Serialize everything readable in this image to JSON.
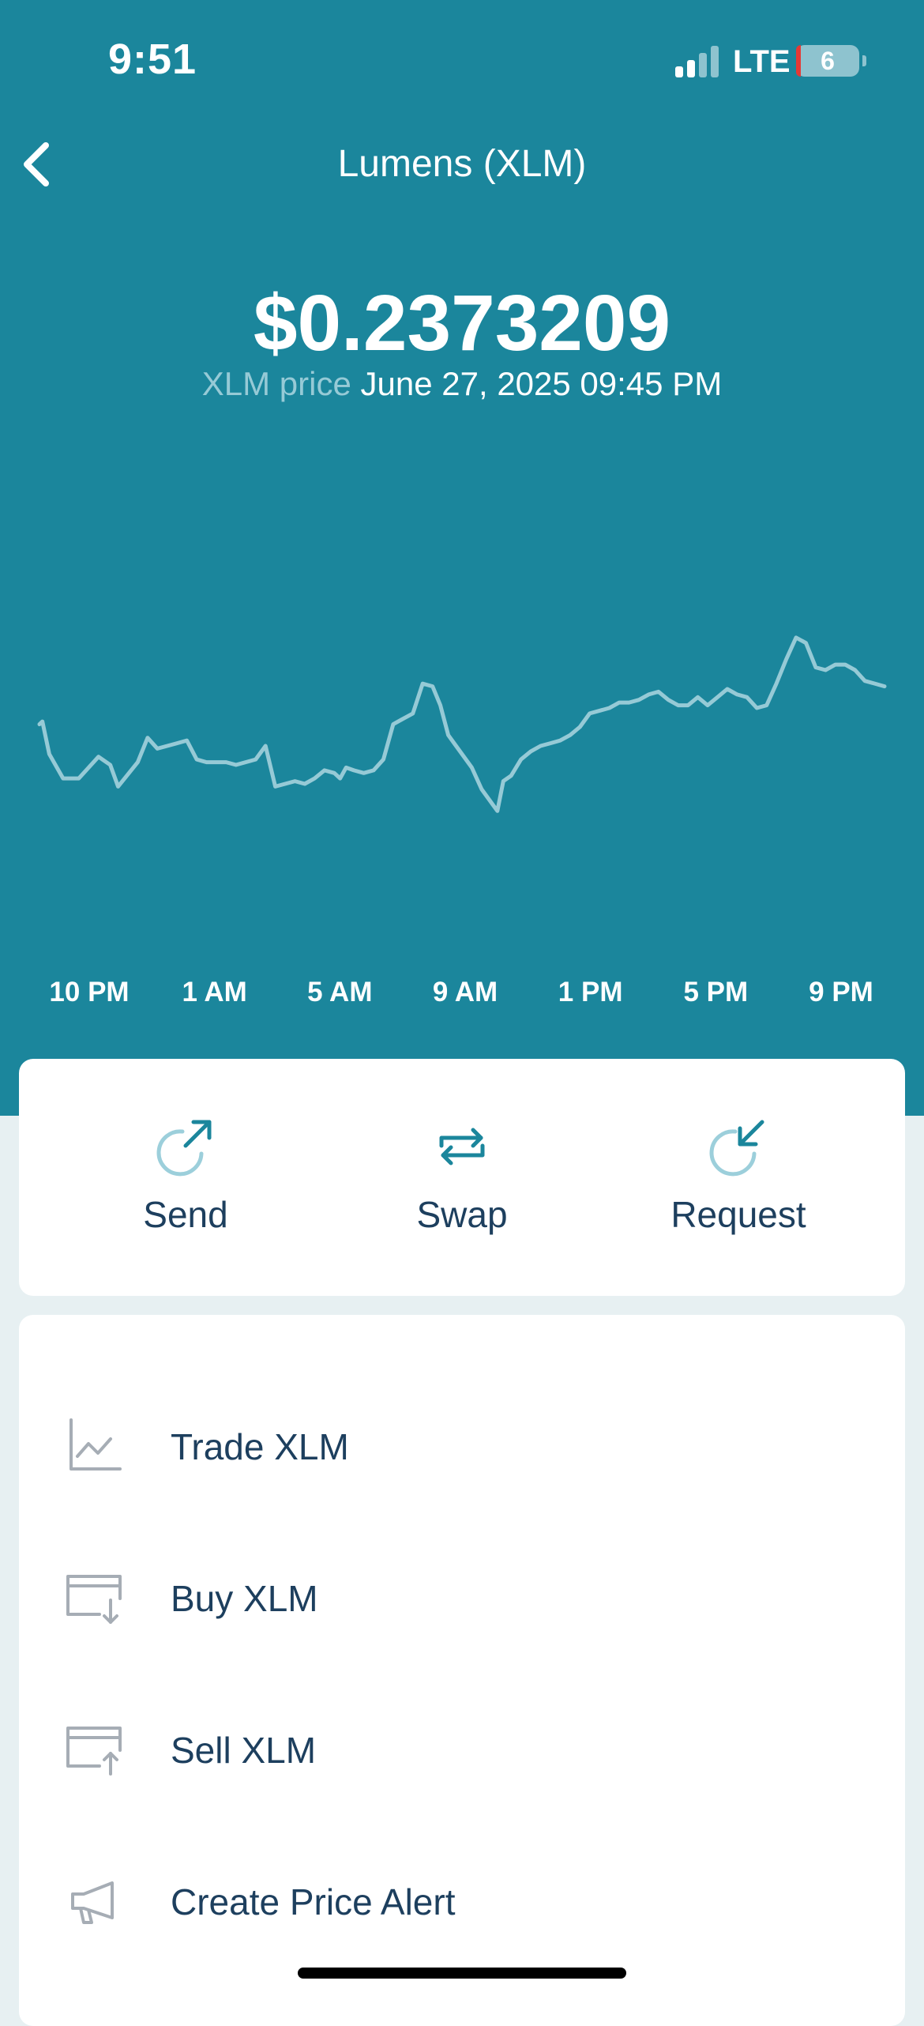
{
  "status_bar": {
    "time": "9:51",
    "network": "LTE",
    "battery": "6"
  },
  "header": {
    "title": "Lumens (XLM)"
  },
  "price": {
    "value": "$0.2373209",
    "label": "XLM price",
    "datetime": "June 27, 2025 09:45 PM"
  },
  "chart_data": {
    "type": "line",
    "x_ticks": [
      "10 PM",
      "1 AM",
      "5 AM",
      "9 AM",
      "1 PM",
      "5 PM",
      "9 PM"
    ],
    "ylim": [
      0.2255,
      0.2395
    ],
    "line_color": "#96cad6",
    "series": [
      {
        "points": [
          [
            0,
            0.2326
          ],
          [
            0.15,
            0.2327
          ],
          [
            0.5,
            0.2315
          ],
          [
            1.2,
            0.2306
          ],
          [
            2,
            0.2306
          ],
          [
            3,
            0.2314
          ],
          [
            3.6,
            0.2311
          ],
          [
            4,
            0.2303
          ],
          [
            5,
            0.2312
          ],
          [
            5.5,
            0.2321
          ],
          [
            6,
            0.2317
          ],
          [
            7,
            0.2319
          ],
          [
            7.5,
            0.232
          ],
          [
            8,
            0.2313
          ],
          [
            8.5,
            0.2312
          ],
          [
            9.5,
            0.2312
          ],
          [
            10,
            0.2311
          ],
          [
            11,
            0.2313
          ],
          [
            11.5,
            0.2318
          ],
          [
            12,
            0.2303
          ],
          [
            13,
            0.2305
          ],
          [
            13.5,
            0.2304
          ],
          [
            14,
            0.2306
          ],
          [
            14.5,
            0.2309
          ],
          [
            15,
            0.2308
          ],
          [
            15.3,
            0.2306
          ],
          [
            15.6,
            0.231
          ],
          [
            16,
            0.2309
          ],
          [
            16.5,
            0.2308
          ],
          [
            17,
            0.2309
          ],
          [
            17.5,
            0.2313
          ],
          [
            18,
            0.2326
          ],
          [
            18.5,
            0.2328
          ],
          [
            19,
            0.233
          ],
          [
            19.5,
            0.2341
          ],
          [
            20,
            0.234
          ],
          [
            20.4,
            0.2333
          ],
          [
            20.8,
            0.2322
          ],
          [
            21.2,
            0.2318
          ],
          [
            22,
            0.231
          ],
          [
            22.5,
            0.2302
          ],
          [
            23,
            0.2297
          ],
          [
            23.3,
            0.2294
          ],
          [
            23.6,
            0.2305
          ],
          [
            24,
            0.2307
          ],
          [
            24.5,
            0.2313
          ],
          [
            25,
            0.2316
          ],
          [
            25.5,
            0.2318
          ],
          [
            26,
            0.2319
          ],
          [
            26.5,
            0.232
          ],
          [
            27,
            0.2322
          ],
          [
            27.5,
            0.2325
          ],
          [
            28,
            0.233
          ],
          [
            29,
            0.2332
          ],
          [
            29.5,
            0.2334
          ],
          [
            30,
            0.2334
          ],
          [
            30.5,
            0.2335
          ],
          [
            31,
            0.2337
          ],
          [
            31.5,
            0.2338
          ],
          [
            32,
            0.2335
          ],
          [
            32.5,
            0.2333
          ],
          [
            33,
            0.2333
          ],
          [
            33.5,
            0.2336
          ],
          [
            34,
            0.2333
          ],
          [
            34.5,
            0.2336
          ],
          [
            35,
            0.2339
          ],
          [
            35.5,
            0.2337
          ],
          [
            36,
            0.2336
          ],
          [
            36.5,
            0.2332
          ],
          [
            37,
            0.2333
          ],
          [
            37.5,
            0.2341
          ],
          [
            38,
            0.235
          ],
          [
            38.5,
            0.2358
          ],
          [
            39,
            0.2356
          ],
          [
            39.5,
            0.2347
          ],
          [
            40,
            0.2346
          ],
          [
            40.5,
            0.2348
          ],
          [
            41,
            0.2348
          ],
          [
            41.5,
            0.2346
          ],
          [
            42,
            0.2342
          ],
          [
            42.5,
            0.2341
          ],
          [
            43,
            0.234
          ]
        ]
      }
    ]
  },
  "actions": [
    {
      "label": "Send",
      "icon": "send-icon"
    },
    {
      "label": "Swap",
      "icon": "swap-icon"
    },
    {
      "label": "Request",
      "icon": "request-icon"
    }
  ],
  "menu": [
    {
      "label": "Trade XLM",
      "icon": "trade-chart-icon"
    },
    {
      "label": "Buy XLM",
      "icon": "buy-card-icon"
    },
    {
      "label": "Sell XLM",
      "icon": "sell-card-icon"
    },
    {
      "label": "Create Price Alert",
      "icon": "megaphone-icon"
    }
  ]
}
